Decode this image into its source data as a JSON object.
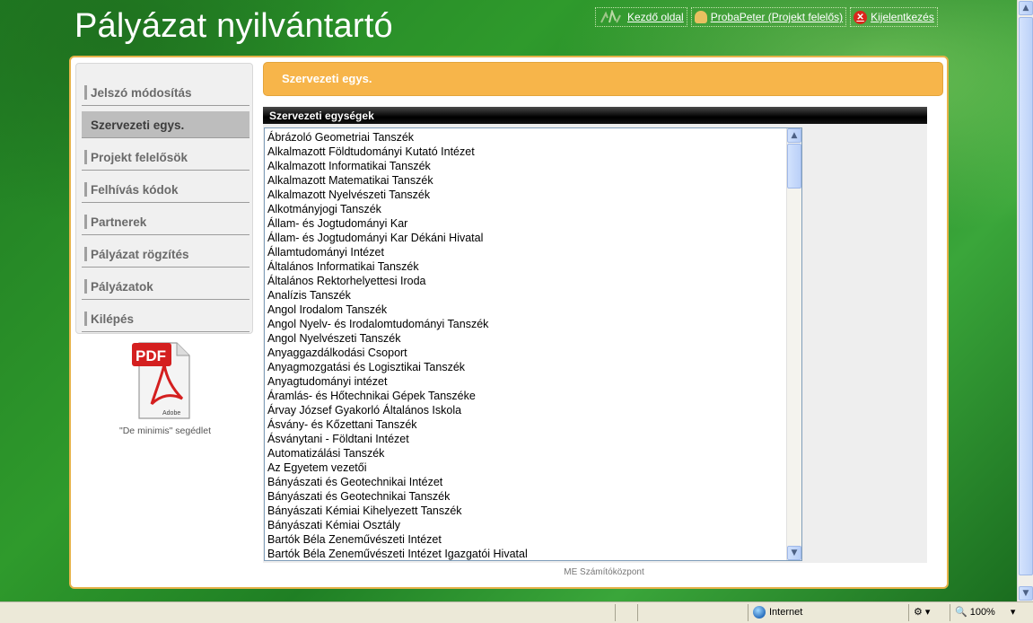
{
  "header": {
    "title": "Pályázat nyilvántartó",
    "links": [
      {
        "label": "Kezdő oldal",
        "icon": "home-icon"
      },
      {
        "label": "ProbaPeter (Projekt felelős)",
        "icon": "user-icon"
      },
      {
        "label": "Kijelentkezés",
        "icon": "logout-icon"
      }
    ]
  },
  "sidebar": {
    "items": [
      {
        "label": "Jelszó módosítás",
        "active": false
      },
      {
        "label": "Szervezeti egys.",
        "active": true
      },
      {
        "label": "Projekt felelősök",
        "active": false
      },
      {
        "label": "Felhívás kódok",
        "active": false
      },
      {
        "label": "Partnerek",
        "active": false
      },
      {
        "label": "Pályázat rögzítés",
        "active": false
      },
      {
        "label": "Pályázatok",
        "active": false
      },
      {
        "label": "Kilépés",
        "active": false
      }
    ],
    "pdf_badge": "PDF",
    "pdf_brand": "Adobe",
    "pdf_caption": "\"De minimis\" segédlet"
  },
  "main": {
    "section_title": "Szervezeti egys.",
    "list_title": "Szervezeti egységek",
    "units": [
      "Ábrázoló Geometriai Tanszék",
      "Alkalmazott Földtudományi Kutató Intézet",
      "Alkalmazott Informatikai Tanszék",
      "Alkalmazott Matematikai Tanszék",
      "Alkalmazott Nyelvészeti Tanszék",
      "Alkotmányjogi Tanszék",
      "Állam- és Jogtudományi Kar",
      "Állam- és Jogtudományi Kar Dékáni Hivatal",
      "Államtudományi Intézet",
      "Általános Informatikai Tanszék",
      "Általános Rektorhelyettesi Iroda",
      "Analízis Tanszék",
      "Angol Irodalom Tanszék",
      "Angol Nyelv- és Irodalomtudományi Tanszék",
      "Angol Nyelvészeti Tanszék",
      "Anyaggazdálkodási Csoport",
      "Anyagmozgatási és Logisztikai Tanszék",
      "Anyagtudományi intézet",
      "Áramlás- és Hőtechnikai Gépek Tanszéke",
      "Árvay József Gyakorló Általános Iskola",
      "Ásvány- és Kőzettani Tanszék",
      "Ásványtani - Földtani Intézet",
      "Automatizálási Tanszék",
      "Az Egyetem vezetői",
      "Bányászati és Geotechnikai Intézet",
      "Bányászati és Geotechnikai Tanszék",
      "Bányászati Kémiai Kihelyezett Tanszék",
      "Bányászati Kémiai Osztály",
      "Bartók Béla Zeneművészeti Intézet",
      "Bartók Béla Zeneművészeti Intézet Igazgatói Hivatal"
    ],
    "footer": "ME Számítóközpont"
  },
  "statusbar": {
    "zone": "Internet",
    "zoom": "100%"
  }
}
